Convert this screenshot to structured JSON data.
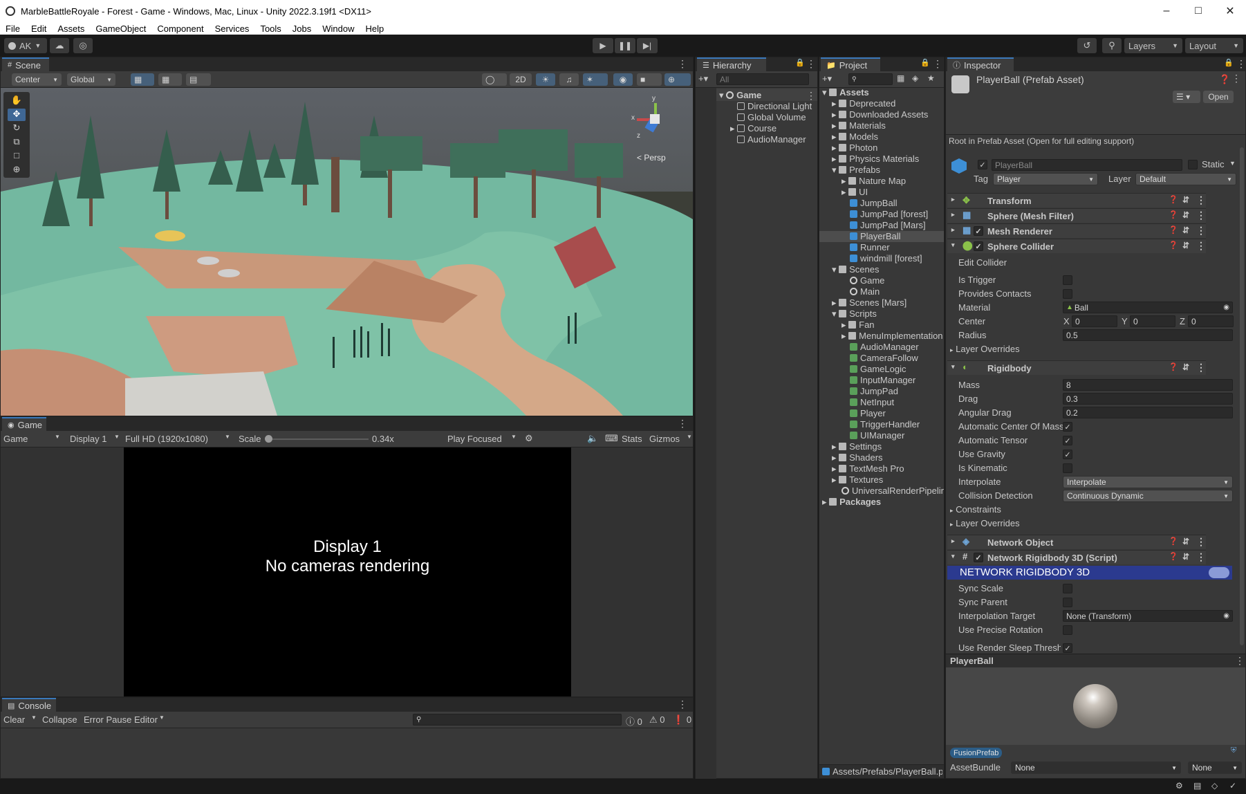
{
  "window": {
    "title": "MarbleBattleRoyale - Forest - Game - Windows, Mac, Linux - Unity 2022.3.19f1 <DX11>"
  },
  "menu": [
    "File",
    "Edit",
    "Assets",
    "GameObject",
    "Component",
    "Services",
    "Tools",
    "Jobs",
    "Window",
    "Help"
  ],
  "toolbar": {
    "account": "AK",
    "layers": "Layers",
    "layout": "Layout"
  },
  "scene": {
    "tab": "Scene",
    "pivot": "Center",
    "space": "Global",
    "mode2d": "2D",
    "persp": "< Persp",
    "gizmo_axes": {
      "x": "x",
      "y": "y",
      "z": "z"
    }
  },
  "game": {
    "tab": "Game",
    "view": "Game",
    "display": "Display 1",
    "resolution": "Full HD (1920x1080)",
    "scale_label": "Scale",
    "scale_value": "0.34x",
    "play_mode": "Play Focused",
    "stats": "Stats",
    "gizmos": "Gizmos",
    "message_line1": "Display 1",
    "message_line2": "No cameras rendering"
  },
  "console": {
    "tab": "Console",
    "clear": "Clear",
    "collapse": "Collapse",
    "error_pause": "Error Pause",
    "editor": "Editor",
    "log_count": "0",
    "warn_count": "0",
    "error_count": "0"
  },
  "hierarchy": {
    "tab": "Hierarchy",
    "search_placeholder": "All",
    "items": [
      {
        "label": "Game"
      },
      {
        "label": "Directional Light"
      },
      {
        "label": "Global Volume"
      },
      {
        "label": "Course"
      },
      {
        "label": "AudioManager"
      }
    ]
  },
  "project": {
    "tab": "Project",
    "items": [
      {
        "label": "Assets"
      },
      {
        "label": "Deprecated"
      },
      {
        "label": "Downloaded Assets"
      },
      {
        "label": "Materials"
      },
      {
        "label": "Models"
      },
      {
        "label": "Photon"
      },
      {
        "label": "Physics Materials"
      },
      {
        "label": "Prefabs"
      },
      {
        "label": "Nature Map"
      },
      {
        "label": "UI"
      },
      {
        "label": "JumpBall"
      },
      {
        "label": "JumpPad [forest]"
      },
      {
        "label": "JumpPad [Mars]"
      },
      {
        "label": "PlayerBall"
      },
      {
        "label": "Runner"
      },
      {
        "label": "windmill [forest]"
      },
      {
        "label": "Scenes"
      },
      {
        "label": "Game"
      },
      {
        "label": "Main"
      },
      {
        "label": "Scenes [Mars]"
      },
      {
        "label": "Scripts"
      },
      {
        "label": "Fan"
      },
      {
        "label": "MenuImplementation"
      },
      {
        "label": "AudioManager"
      },
      {
        "label": "CameraFollow"
      },
      {
        "label": "GameLogic"
      },
      {
        "label": "InputManager"
      },
      {
        "label": "JumpPad"
      },
      {
        "label": "NetInput"
      },
      {
        "label": "Player"
      },
      {
        "label": "TriggerHandler"
      },
      {
        "label": "UIManager"
      },
      {
        "label": "Settings"
      },
      {
        "label": "Shaders"
      },
      {
        "label": "TextMesh Pro"
      },
      {
        "label": "Textures"
      },
      {
        "label": "UniversalRenderPipelin"
      },
      {
        "label": "Packages"
      }
    ],
    "path": "Assets/Prefabs/PlayerBall.p"
  },
  "inspector": {
    "tab": "Inspector",
    "asset_title": "PlayerBall (Prefab Asset)",
    "open": "Open",
    "root_note": "Root in Prefab Asset (Open for full editing support)",
    "name": "PlayerBall",
    "static": "Static",
    "tag_label": "Tag",
    "tag_value": "Player",
    "layer_label": "Layer",
    "layer_value": "Default",
    "components": {
      "transform": "Transform",
      "mesh_filter": "Sphere (Mesh Filter)",
      "mesh_renderer": "Mesh Renderer",
      "sphere_collider": "Sphere Collider",
      "rigidbody": "Rigidbody",
      "network_object": "Network Object",
      "network_rigidbody": "Network Rigidbody 3D (Script)"
    },
    "collider": {
      "edit_collider": "Edit Collider",
      "is_trigger": "Is Trigger",
      "provides_contacts": "Provides Contacts",
      "material_label": "Material",
      "material_value": "Ball",
      "center_label": "Center",
      "cx": "0",
      "cy": "0",
      "cz": "0",
      "radius_label": "Radius",
      "radius_value": "0.5",
      "layer_overrides": "Layer Overrides"
    },
    "rigidbody": {
      "mass_label": "Mass",
      "mass": "8",
      "drag_label": "Drag",
      "drag": "0.3",
      "angular_drag_label": "Angular Drag",
      "angular_drag": "0.2",
      "auto_center_label": "Automatic Center Of Mass",
      "auto_tensor_label": "Automatic Tensor",
      "use_gravity_label": "Use Gravity",
      "is_kinematic_label": "Is Kinematic",
      "interpolate_label": "Interpolate",
      "interpolate": "Interpolate",
      "collision_label": "Collision Detection",
      "collision": "Continuous Dynamic",
      "constraints": "Constraints",
      "layer_overrides": "Layer Overrides"
    },
    "network_rb": {
      "banner": "NETWORK RIGIDBODY 3D",
      "sync_scale": "Sync Scale",
      "sync_parent": "Sync Parent",
      "interp_target_label": "Interpolation Target",
      "interp_target": "None (Transform)",
      "precise_rotation": "Use Precise Rotation",
      "render_sleep": "Use Render Sleep Thresho"
    },
    "preview": {
      "title": "PlayerBall",
      "label_tag": "FusionPrefab",
      "assetbundle_label": "AssetBundle",
      "assetbundle_value": "None",
      "variant_value": "None"
    }
  },
  "colors": {
    "accent": "#3a79bb",
    "selection": "#2c5d87",
    "banner": "#2b3a8f",
    "panel": "#383838",
    "dark": "#191919"
  }
}
